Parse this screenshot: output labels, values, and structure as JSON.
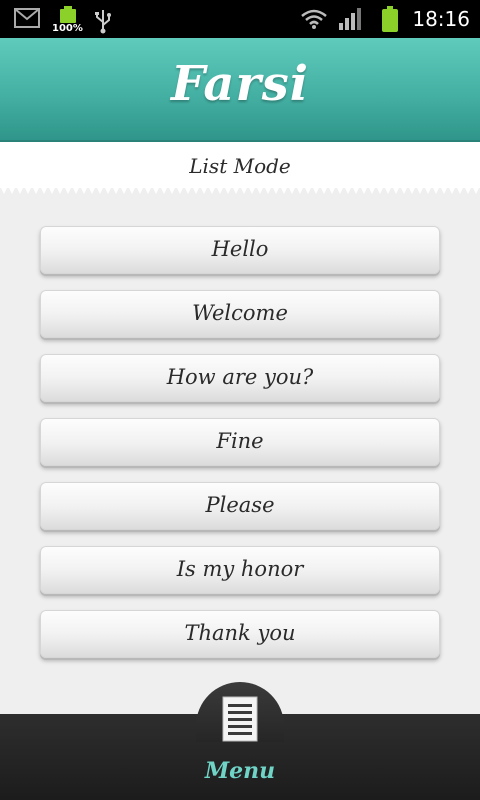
{
  "status_bar": {
    "battery_small_text": "100%",
    "time": "18:16",
    "icons": [
      "gmail-icon",
      "battery-icon",
      "usb-icon",
      "wifi-icon",
      "signal-icon",
      "battery-icon"
    ]
  },
  "header": {
    "title": "Farsi"
  },
  "mode": {
    "label": "List Mode"
  },
  "phrases": [
    {
      "label": "Hello"
    },
    {
      "label": "Welcome"
    },
    {
      "label": "How are you?"
    },
    {
      "label": "Fine"
    },
    {
      "label": "Please"
    },
    {
      "label": "Is my honor"
    },
    {
      "label": "Thank you"
    }
  ],
  "bottom_bar": {
    "menu_label": "Menu",
    "menu_icon": "document-list-icon"
  },
  "colors": {
    "header_teal": "#44b0a3",
    "menu_label_teal": "#6fd3c6",
    "battery_green": "#8bd12a"
  }
}
